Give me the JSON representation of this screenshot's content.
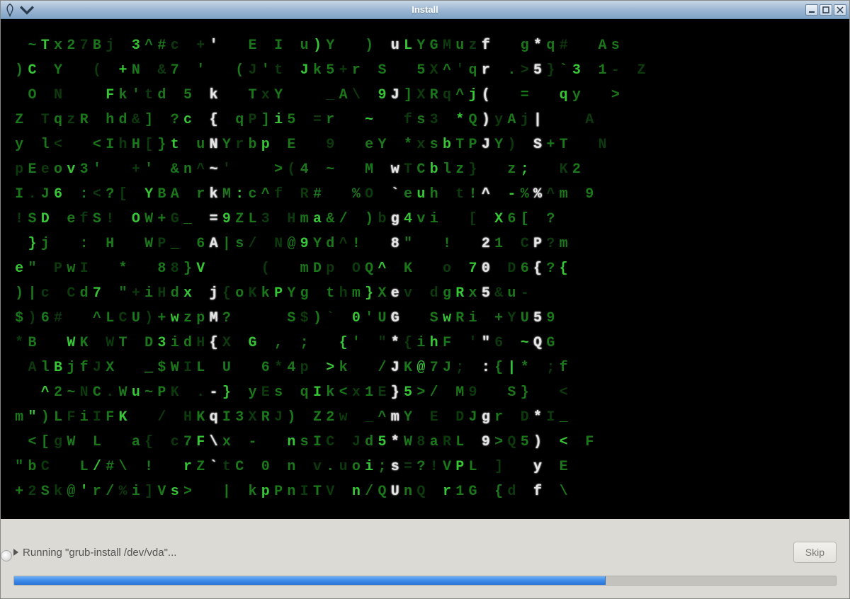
{
  "window": {
    "title": "Install"
  },
  "status": {
    "text": "Running \"grub-install /dev/vda\"...",
    "skip_label": "Skip",
    "progress_pct": 72
  },
  "matrix": {
    "cols": 63,
    "rows": 19,
    "white_columns": [
      15,
      29,
      36,
      40,
      47,
      53,
      59
    ],
    "lines": [
      " ~Tx27Bj 3^#c +'  E I u)Y  ) uLYGMuzf  g*q#  As ",
      ")C Y  ( +N &7 '  (J't Jk5+r S  5X^'qr .>5}`3 1- Z",
      " O N   Fk'td 5 k  TxY   _A\\ 9J]XRq^j(  =  qy  >  ",
      "Z TqzR hd&] ?c { qP]i5 =r  ~  fs3 *Q)yAj|   A   ",
      "y l<  <IhH[}t uNYrbp E  9  eY *xsbTPJY) S+T  N ",
      "pEeov3'  +' &n^~'   >(4 ~  M wTCblz}  z;  K2   ",
      "I.J6 :<?[ YBA rkM:c^f R#  %O `euh t!^ -%%^m 9",
      "!SD efS! OW+G_ =9ZL3 Hma&/ )bg4vi  [ X6[ ?  ",
      " }j  : H  WP_ 6A|s/ N@9Yd^!  8\"  !  21 CP?m  ",
      "e\" PwI  *  88}V    (  mDp OQ^ K  o 70 D6{?{",
      ")|c Cd7 \"+iHdx j{oKkPYg thm}Xev dgRx5&u-",
      "$)6#  ^LCU)+wzpM?    S$)` 0'UG  SwRi +YU59",
      "*B  WK WT D3idH{X G , ;  {' \"*{ihF '\"6 ~QG",
      " AlBjfJX  _$WIL U  6*4p >k  /JK@7J; :{|* ;f",
      "  ^2~NC.Wu~PK .-} yEs qIk<x1E}5>/ M9  S}  < ",
      "m\")LFiIFK  / HKqI3XRJ) Z2w _^mY E DJgr D*I_",
      " <[gW L  a{ c7F\\x -  nsIC Jd5*W8aRL 9>Q5) < F",
      "\"bC  L/#\\ !  rZ`tC 0 n v.uoi;s=?!VPL ]  y E",
      "+2Sk@'r/%i]Vs>  | kpPnITV n/QUnQ r1G {d f \\"
    ]
  }
}
